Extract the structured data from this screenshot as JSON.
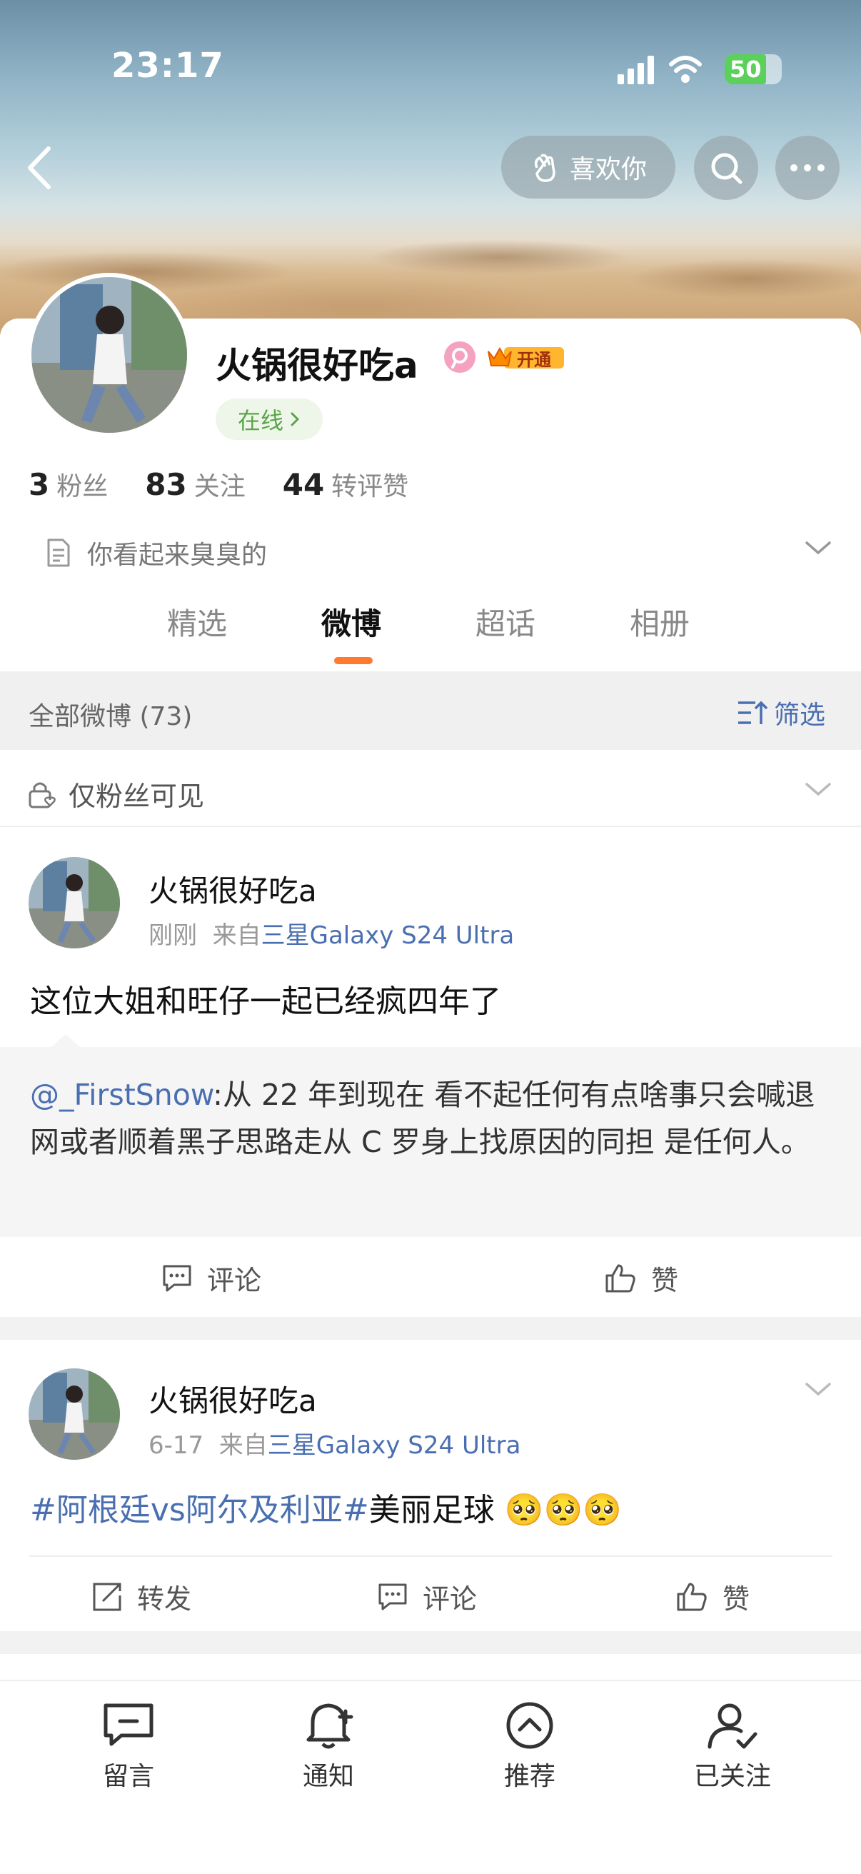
{
  "status": {
    "time": "23:17",
    "battery": "50"
  },
  "header": {
    "like_label": "喜欢你"
  },
  "profile": {
    "name": "火锅很好吃a",
    "vip_label": "开通",
    "online_label": "在线",
    "stats": [
      {
        "value": "3",
        "label": "粉丝"
      },
      {
        "value": "83",
        "label": "关注"
      },
      {
        "value": "44",
        "label": "转评赞"
      }
    ],
    "bio": "你看起来臭臭的"
  },
  "tabs": [
    "精选",
    "微博",
    "超话",
    "相册"
  ],
  "active_tab": "微博",
  "filter": {
    "summary": "全部微博 (73)",
    "filter_label": "筛选"
  },
  "visibility": {
    "label": "仅粉丝可见"
  },
  "posts": [
    {
      "author": "火锅很好吃a",
      "time": "刚刚",
      "from_prefix": "来自",
      "device": "三星Galaxy S24 Ultra",
      "text": "这位大姐和旺仔一起已经疯四年了",
      "quote_at": "@_FirstSnow",
      "quote_text": ":从 22 年到现在 看不起任何有点啥事只会喊退网或者顺着黑子思路走从 C 罗身上找原因的同担 是任何人。",
      "actions": {
        "comment": "评论",
        "like": "赞"
      }
    },
    {
      "author": "火锅很好吃a",
      "time": "6-17",
      "from_prefix": "来自",
      "device": "三星Galaxy S24 Ultra",
      "topic": "#阿根廷vs阿尔及利亚#",
      "text": "美丽足球",
      "emoji": [
        "🥺",
        "🥺",
        "🥺"
      ],
      "actions": {
        "repost": "转发",
        "comment": "评论",
        "like": "赞"
      }
    }
  ],
  "bottom_nav": [
    {
      "label": "留言",
      "icon": "message-icon"
    },
    {
      "label": "通知",
      "icon": "bell-plus-icon"
    },
    {
      "label": "推荐",
      "icon": "chevron-up-circle-icon"
    },
    {
      "label": "已关注",
      "icon": "user-check-icon"
    }
  ],
  "colors": {
    "accent": "#ff7a2f",
    "link": "#4a6fb0",
    "online": "#5aa54a"
  }
}
